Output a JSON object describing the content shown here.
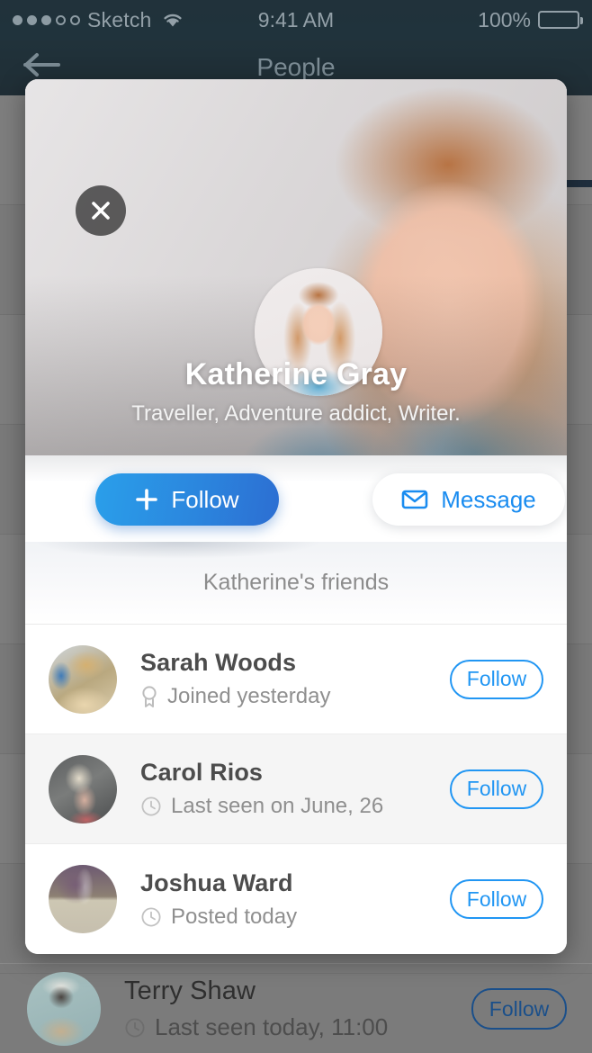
{
  "status_bar": {
    "carrier": "Sketch",
    "signal_dots_filled": 3,
    "signal_dots_total": 5,
    "wifi_icon": "wifi-icon",
    "time": "9:41 AM",
    "battery_percent": "100%",
    "battery_icon": "battery-full-icon",
    "text_color": "#93a0a8",
    "background_color": "#174257"
  },
  "nav_bar": {
    "back_icon": "arrow-left-icon",
    "title": "People"
  },
  "modal": {
    "close_icon": "close-icon",
    "profile": {
      "name": "Katherine Gray",
      "tagline": "Traveller, Adventure addict, Writer.",
      "avatar_alt": "katherine-gray-avatar",
      "cover_alt": "katherine-gray-cover-photo"
    },
    "actions": {
      "follow_label": "Follow",
      "follow_icon": "plus-icon",
      "follow_gradient_from": "#2a9fea",
      "follow_gradient_to": "#2c6ed2",
      "message_label": "Message",
      "message_icon": "envelope-icon",
      "message_color": "#1a8cf0"
    },
    "friends_section": {
      "header": "Katherine's friends",
      "accent_color": "#2196f3",
      "rows": [
        {
          "name": "Sarah Woods",
          "status_icon": "award-icon",
          "status": "Joined yesterday",
          "follow_label": "Follow",
          "avatar_alt": "sarah-woods-avatar",
          "shaded": false
        },
        {
          "name": "Carol Rios",
          "status_icon": "clock-icon",
          "status": "Last seen on June, 26",
          "follow_label": "Follow",
          "avatar_alt": "carol-rios-avatar",
          "shaded": true
        },
        {
          "name": "Joshua Ward",
          "status_icon": "clock-icon",
          "status": "Posted today",
          "follow_label": "Follow",
          "avatar_alt": "joshua-ward-avatar",
          "shaded": false
        }
      ]
    }
  },
  "background_row": {
    "name": "Terry Shaw",
    "status_icon": "clock-icon",
    "status": "Last seen today, 11:00",
    "follow_label": "Follow",
    "avatar_alt": "terry-shaw-avatar"
  }
}
